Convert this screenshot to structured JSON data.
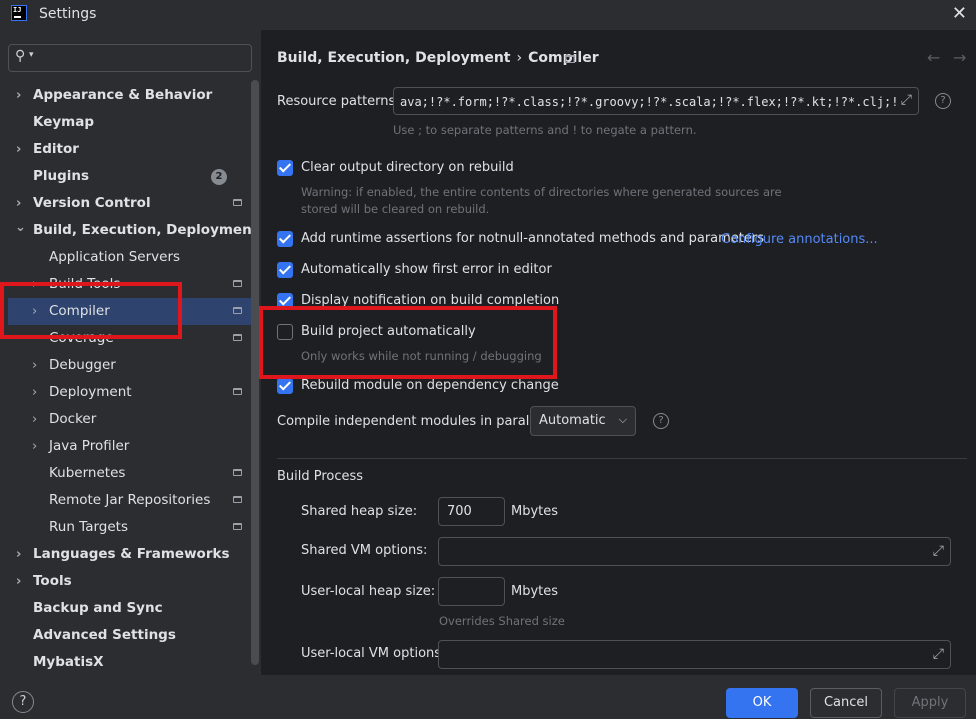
{
  "window": {
    "title": "Settings",
    "logo_text": "IJ"
  },
  "sidebar": {
    "search_placeholder": "",
    "items": [
      {
        "label": "Appearance & Behavior",
        "chevron": "›"
      },
      {
        "label": "Keymap"
      },
      {
        "label": "Editor",
        "chevron": "›"
      },
      {
        "label": "Plugins",
        "badge": "2"
      },
      {
        "label": "Version Control",
        "chevron": "›"
      },
      {
        "label": "Build, Execution, Deployment",
        "chevron": "⌄"
      },
      {
        "label": "Application Servers"
      },
      {
        "label": "Build Tools",
        "chevron": "›"
      },
      {
        "label": "Compiler",
        "chevron": "›"
      },
      {
        "label": "Coverage"
      },
      {
        "label": "Debugger",
        "chevron": "›"
      },
      {
        "label": "Deployment",
        "chevron": "›"
      },
      {
        "label": "Docker",
        "chevron": "›"
      },
      {
        "label": "Java Profiler",
        "chevron": "›"
      },
      {
        "label": "Kubernetes"
      },
      {
        "label": "Remote Jar Repositories"
      },
      {
        "label": "Run Targets"
      },
      {
        "label": "Languages & Frameworks",
        "chevron": "›"
      },
      {
        "label": "Tools",
        "chevron": "›"
      },
      {
        "label": "Backup and Sync"
      },
      {
        "label": "Advanced Settings"
      },
      {
        "label": "MybatisX"
      }
    ]
  },
  "breadcrumb": {
    "parent": "Build, Execution, Deployment",
    "separator": "›",
    "current": "Compiler"
  },
  "nav": {
    "back": "←",
    "forward": "→"
  },
  "resource_patterns": {
    "label": "Resource patterns:",
    "value": "ava;!?*.form;!?*.class;!?*.groovy;!?*.scala;!?*.flex;!?*.kt;!?*.clj;!?",
    "hint": "Use ; to separate patterns and ! to negate a pattern."
  },
  "options": {
    "clear_output": {
      "label": "Clear output directory on rebuild",
      "checked": true,
      "warning_line1": "Warning: if enabled, the entire contents of directories where generated sources are",
      "warning_line2": "stored will be cleared on rebuild."
    },
    "runtime_assertions": {
      "label": "Add runtime assertions for notnull-annotated methods and parameters",
      "checked": true,
      "link": "Configure annotations..."
    },
    "show_first_error": {
      "label": "Automatically show first error in editor",
      "checked": true
    },
    "display_notification": {
      "label": "Display notification on build completion",
      "checked": true
    },
    "build_auto": {
      "label": "Build project automatically",
      "checked": false,
      "hint": "Only works while not running / debugging"
    },
    "rebuild_module": {
      "label": "Rebuild module on dependency change",
      "checked": true
    }
  },
  "parallel": {
    "label": "Compile independent modules in parallel:",
    "value": "Automatic",
    "help": "?"
  },
  "build_process": {
    "title": "Build Process",
    "shared_heap": {
      "label": "Shared heap size:",
      "value": "700",
      "unit": "Mbytes"
    },
    "shared_vm": {
      "label": "Shared VM options:",
      "value": ""
    },
    "user_heap": {
      "label": "User-local heap size:",
      "value": "",
      "unit": "Mbytes",
      "hint": "Overrides Shared size"
    },
    "user_vm": {
      "label": "User-local VM options:",
      "value": ""
    }
  },
  "footer": {
    "help": "?",
    "ok": "OK",
    "cancel": "Cancel",
    "apply": "Apply"
  },
  "colors": {
    "accent": "#3574f0",
    "highlight_box": "#e0161d",
    "selection": "#2e436e",
    "link": "#548af7"
  }
}
